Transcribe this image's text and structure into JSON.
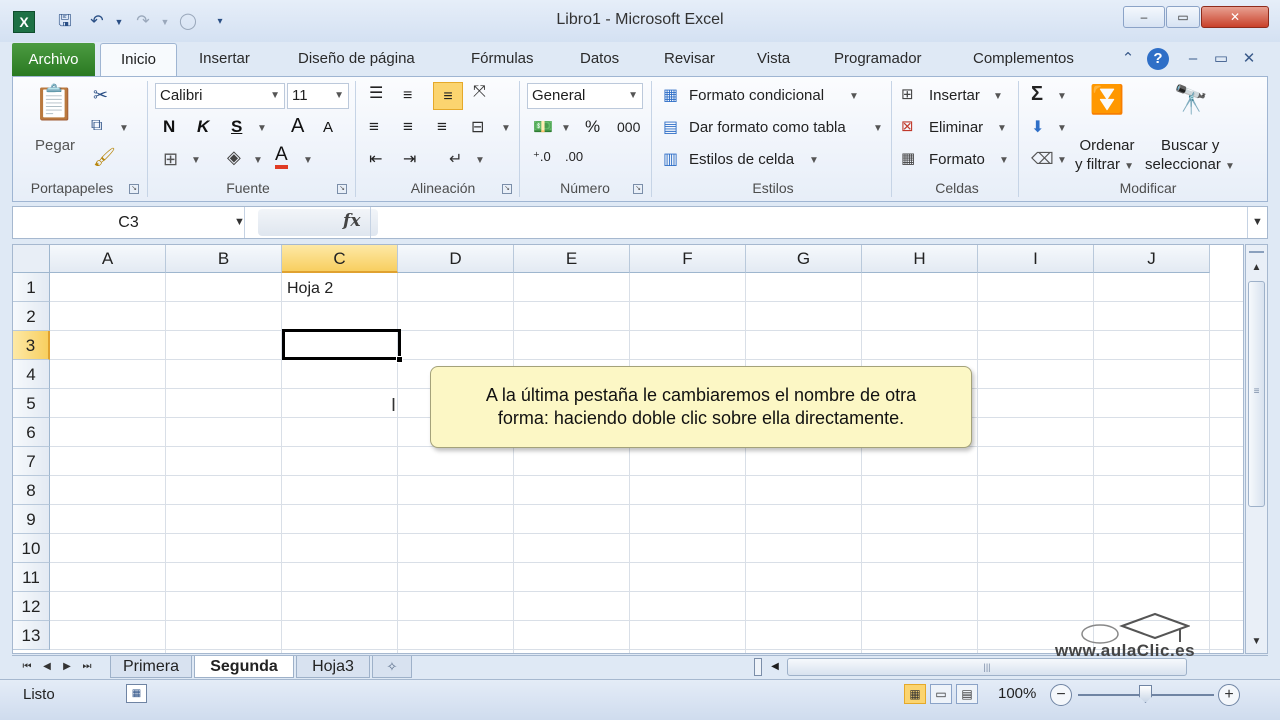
{
  "window": {
    "title": "Libro1",
    "app": "Microsoft Excel",
    "minimize": "–",
    "restore": "▭",
    "close": "✕",
    "ribbon_min": "–",
    "ribbon_restore": "▭",
    "ribbon_close": "✕"
  },
  "qat": {
    "icon_app": "X",
    "save": "🖫",
    "undo": "↶",
    "redo": "↷"
  },
  "tabs": {
    "file": "Archivo",
    "items": [
      "Inicio",
      "Insertar",
      "Diseño de página",
      "Fórmulas",
      "Datos",
      "Revisar",
      "Vista",
      "Programador",
      "Complementos"
    ],
    "help": "?"
  },
  "ribbon": {
    "clipboard": {
      "label": "Portapapeles",
      "paste": "Pegar"
    },
    "font": {
      "label": "Fuente",
      "name": "Calibri",
      "size": "11",
      "bold": "N",
      "italic": "K",
      "underline": "S",
      "grow": "A",
      "shrink": "A",
      "color_letter": "A"
    },
    "alignment": {
      "label": "Alineación"
    },
    "number": {
      "label": "Número",
      "format": "General",
      "percent": "%",
      "thousands": "000"
    },
    "styles": {
      "label": "Estilos",
      "conditional": "Formato condicional",
      "table": "Dar formato como tabla",
      "cell_styles": "Estilos de celda"
    },
    "cells": {
      "label": "Celdas",
      "insert": "Insertar",
      "delete": "Eliminar",
      "format": "Formato"
    },
    "editing": {
      "label": "Modificar",
      "sigma": "Σ",
      "sort_line1": "Ordenar",
      "sort_line2": "y filtrar",
      "find_line1": "Buscar y",
      "find_line2": "seleccionar"
    }
  },
  "formula_bar": {
    "name_box": "C3",
    "fx": "fx",
    "formula": ""
  },
  "grid": {
    "columns": [
      "A",
      "B",
      "C",
      "D",
      "E",
      "F",
      "G",
      "H",
      "I",
      "J"
    ],
    "rows": [
      "1",
      "2",
      "3",
      "4",
      "5",
      "6",
      "7",
      "8",
      "9",
      "10",
      "11",
      "12",
      "13"
    ],
    "active_column": "C",
    "active_row": "3",
    "cells": {
      "C1": "Hoja 2"
    }
  },
  "callout": {
    "line1": "A la última pestaña le cambiaremos el nombre de otra",
    "line2": "forma: haciendo doble clic sobre ella directamente."
  },
  "sheets": {
    "tabs": [
      "Primera",
      "Segunda",
      "Hoja3"
    ],
    "active": "Segunda"
  },
  "watermark": "www.aulaClic.es",
  "status": {
    "text": "Listo",
    "zoom": "100%",
    "zoom_out": "−",
    "zoom_in": "+"
  },
  "colors": {
    "file_tab": "#2a7a22",
    "accent": "#fbd46f",
    "callout_bg": "#fcf7c5"
  }
}
